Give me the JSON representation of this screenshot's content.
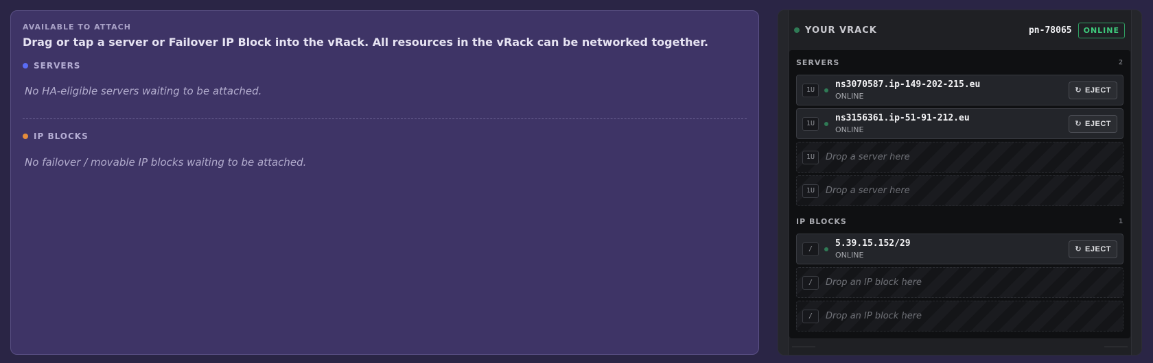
{
  "available": {
    "eyebrow": "AVAILABLE TO ATTACH",
    "headline": "Drag or tap a server or Failover IP Block into the vRack. All resources in the vRack can be networked together.",
    "servers_label": "SERVERS",
    "servers_empty": "No HA-eligible servers waiting to be attached.",
    "ipblocks_label": "IP BLOCKS",
    "ipblocks_empty": "No failover / movable IP blocks waiting to be attached."
  },
  "vrack": {
    "title": "YOUR VRACK",
    "id": "pn-78065",
    "status": "ONLINE",
    "servers": {
      "label": "SERVERS",
      "count": "2",
      "items": [
        {
          "unit": "1U",
          "name": "ns3070587.ip-149-202-215.eu",
          "status": "ONLINE",
          "eject": "EJECT"
        },
        {
          "unit": "1U",
          "name": "ns3156361.ip-51-91-212.eu",
          "status": "ONLINE",
          "eject": "EJECT"
        }
      ],
      "empty_slots": [
        {
          "unit": "1U",
          "text": "Drop a server here"
        },
        {
          "unit": "1U",
          "text": "Drop a server here"
        }
      ]
    },
    "ipblocks": {
      "label": "IP BLOCKS",
      "count": "1",
      "items": [
        {
          "unit": "/",
          "name": "5.39.15.152/29",
          "status": "ONLINE",
          "eject": "EJECT"
        }
      ],
      "empty_slots": [
        {
          "unit": "/",
          "text": "Drop an IP block here"
        },
        {
          "unit": "/",
          "text": "Drop an IP block here"
        }
      ]
    }
  },
  "icons": {
    "eject": "eject-icon"
  },
  "colors": {
    "accent_online": "#3ecb7c",
    "servers_dot": "#5a6cf5",
    "ipblocks_dot": "#e58c3b",
    "panel_bg": "#3e3466",
    "rack_bg": "#1f2024"
  }
}
